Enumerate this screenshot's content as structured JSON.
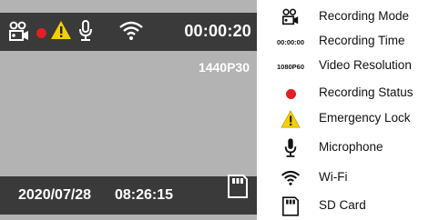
{
  "screen": {
    "time": "00:00:20",
    "resolution": "1440P30",
    "date": "2020/07/28",
    "clock": "08:26:15",
    "colors": {
      "bar": "#3a3a3a",
      "screen": "#b3b3b3",
      "record_dot": "#e41e26",
      "warning": "#f5d000"
    },
    "icons": [
      "recording-mode-icon",
      "recording-status-dot",
      "emergency-lock-icon",
      "microphone-icon",
      "wifi-icon",
      "sd-card-icon"
    ]
  },
  "legend": {
    "items": [
      {
        "icon": "recording-mode-icon",
        "label": "Recording Mode"
      },
      {
        "symbol": "00:00:00",
        "label": "Recording Time"
      },
      {
        "symbol": "1080P60",
        "label": "Video Resolution"
      },
      {
        "icon": "recording-status-dot",
        "label": "Recording Status"
      },
      {
        "icon": "emergency-lock-icon",
        "label": "Emergency Lock"
      },
      {
        "icon": "microphone-icon",
        "label": "Microphone"
      },
      {
        "icon": "wifi-icon",
        "label": "Wi-Fi"
      },
      {
        "icon": "sd-card-icon",
        "label": "SD Card"
      }
    ]
  }
}
